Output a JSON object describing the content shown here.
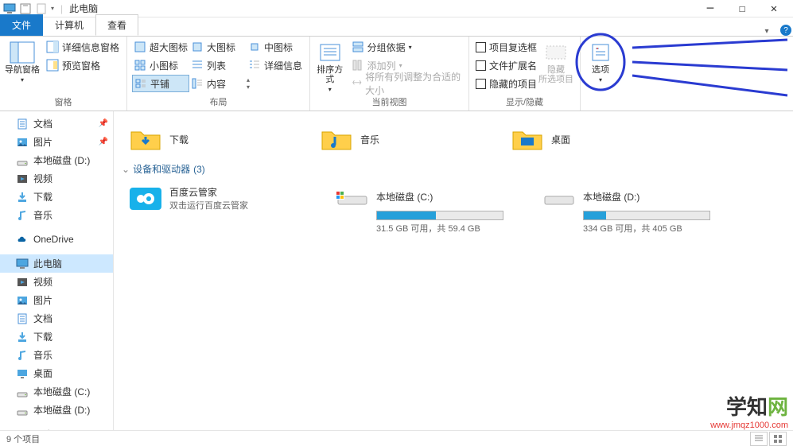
{
  "titlebar": {
    "title": "此电脑"
  },
  "tabs": {
    "file": "文件",
    "computer": "计算机",
    "view": "查看"
  },
  "ribbon": {
    "panes": {
      "nav": "导航窗格",
      "detail_pane": "详细信息窗格",
      "preview_pane": "预览窗格",
      "group_label": "窗格"
    },
    "layout": {
      "xlarge_icon": "超大图标",
      "large_icon": "大图标",
      "medium_icon": "中图标",
      "small_icon": "小图标",
      "list": "列表",
      "details": "详细信息",
      "tiles": "平铺",
      "content": "内容",
      "group_label": "布局"
    },
    "view": {
      "sort": "排序方式",
      "group_by": "分组依据",
      "add_col": "添加列",
      "autosize": "将所有列调整为合适的大小",
      "group_label": "当前视图"
    },
    "showhide": {
      "item_checkbox": "项目复选框",
      "file_ext": "文件扩展名",
      "hidden_items": "隐藏的项目",
      "hide": "隐藏",
      "hide_sub": "所选项目",
      "group_label": "显示/隐藏"
    },
    "options": {
      "label": "选项"
    }
  },
  "sidebar": {
    "items": [
      {
        "label": "文档",
        "icon": "doc",
        "pin": true
      },
      {
        "label": "图片",
        "icon": "pic",
        "pin": true
      },
      {
        "label": "本地磁盘 (D:)",
        "icon": "drive"
      },
      {
        "label": "视频",
        "icon": "video"
      },
      {
        "label": "下载",
        "icon": "download"
      },
      {
        "label": "音乐",
        "icon": "music"
      },
      {
        "label": "OneDrive",
        "icon": "onedrive",
        "gap": true
      },
      {
        "label": "此电脑",
        "icon": "pc",
        "selected": true,
        "gap": true
      },
      {
        "label": "视频",
        "icon": "video"
      },
      {
        "label": "图片",
        "icon": "pic"
      },
      {
        "label": "文档",
        "icon": "doc"
      },
      {
        "label": "下载",
        "icon": "download"
      },
      {
        "label": "音乐",
        "icon": "music"
      },
      {
        "label": "桌面",
        "icon": "desktop"
      },
      {
        "label": "本地磁盘 (C:)",
        "icon": "drive"
      },
      {
        "label": "本地磁盘 (D:)",
        "icon": "drive"
      },
      {
        "label": "网络",
        "icon": "network",
        "gap": true
      }
    ]
  },
  "content": {
    "folder_row": [
      {
        "label": "下载",
        "icon": "download"
      },
      {
        "label": "音乐",
        "icon": "music"
      },
      {
        "label": "桌面",
        "icon": "desktop"
      }
    ],
    "section": {
      "title": "设备和驱动器",
      "count": "(3)"
    },
    "devices": {
      "bdy": {
        "title": "百度云管家",
        "sub": "双击运行百度云管家"
      },
      "c": {
        "title": "本地磁盘 (C:)",
        "sub": "31.5 GB 可用，共 59.4 GB",
        "fill": 47
      },
      "d": {
        "title": "本地磁盘 (D:)",
        "sub": "334 GB 可用，共 405 GB",
        "fill": 18
      }
    }
  },
  "statusbar": {
    "count": "9 个项目"
  },
  "watermark": {
    "line1a": "学知",
    "line1b": "网",
    "line2": "www.jmqz1000.com"
  }
}
